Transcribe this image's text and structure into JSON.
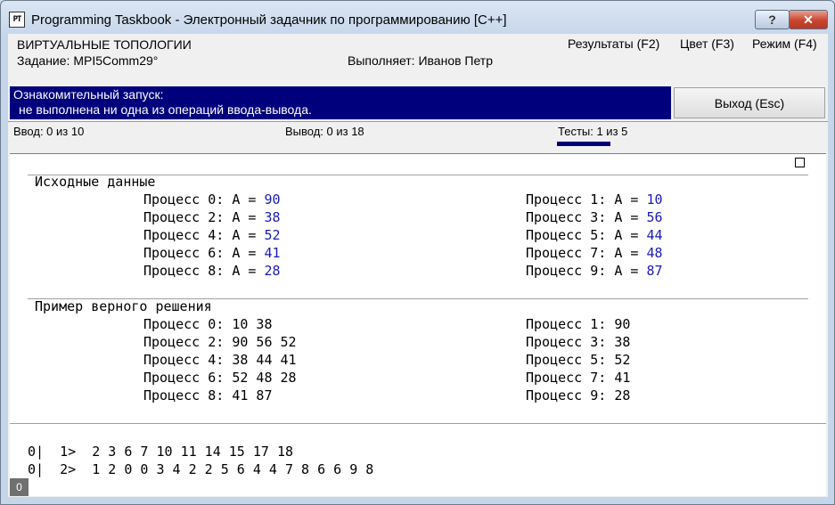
{
  "window": {
    "app_icon": "PT",
    "title": "Programming Taskbook - Электронный задачник по программированию [C++]",
    "help_label": "?",
    "close_label": "✕"
  },
  "header": {
    "section": "ВИРТУАЛЬНЫЕ ТОПОЛОГИИ",
    "task": "Задание: MPI5Comm29°",
    "executor": "Выполняет: Иванов Петр",
    "menu": [
      "Результаты (F2)",
      "Цвет (F3)",
      "Режим (F4)"
    ]
  },
  "status": {
    "line1": "Ознакомительный запуск:",
    "line2": "не выполнена ни одна из операций ввода-вывода."
  },
  "exit_label": "Выход (Esc)",
  "counters": {
    "input": "Ввод: 0 из 10",
    "output": "Вывод: 0 из 18",
    "tests": "Тесты: 1 из 5",
    "tests_progress": 0.2
  },
  "input_section": {
    "title": "Исходные данные",
    "rows": [
      {
        "label": "Процесс 0: A = ",
        "value": "90"
      },
      {
        "label": "Процесс 1: A = ",
        "value": "10"
      },
      {
        "label": "Процесс 2: A = ",
        "value": "38"
      },
      {
        "label": "Процесс 3: A = ",
        "value": "56"
      },
      {
        "label": "Процесс 4: A = ",
        "value": "52"
      },
      {
        "label": "Процесс 5: A = ",
        "value": "44"
      },
      {
        "label": "Процесс 6: A = ",
        "value": "41"
      },
      {
        "label": "Процесс 7: A = ",
        "value": "48"
      },
      {
        "label": "Процесс 8: A = ",
        "value": "28"
      },
      {
        "label": "Процесс 9: A = ",
        "value": "87"
      }
    ]
  },
  "solution_section": {
    "title": "Пример верного решения",
    "rows": [
      "Процесс 0: 10 38",
      "Процесс 1: 90",
      "Процесс 2: 90 56 52",
      "Процесс 3: 38",
      "Процесс 4: 38 44 41",
      "Процесс 5: 52",
      "Процесс 6: 52 48 28",
      "Процесс 7: 41",
      "Процесс 8: 41 87",
      "Процесс 9: 28"
    ]
  },
  "debug_output": [
    "0|  1>  2 3 6 7 10 11 14 15 17 18",
    "0|  2>  1 2 0 0 3 4 2 2 5 6 4 4 7 8 6 6 9 8"
  ],
  "corner_value": "0",
  "colors": {
    "status_bg": "#00007d",
    "value_blue": "#1a1ab8",
    "close_red": "#c9452f"
  }
}
